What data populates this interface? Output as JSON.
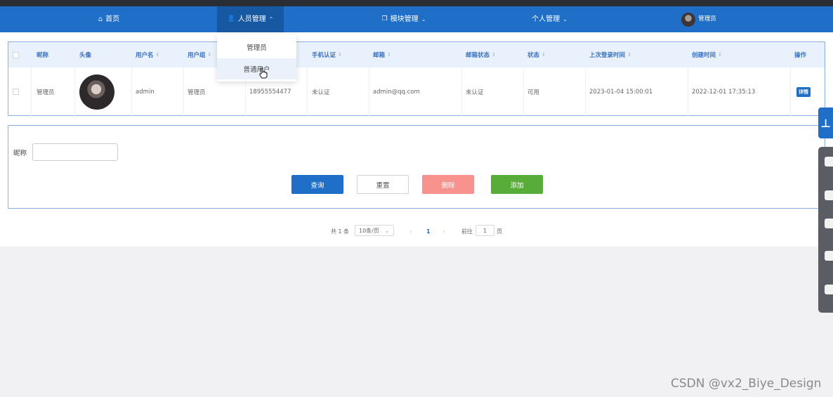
{
  "nav": {
    "home": "首页",
    "people": "人员管理",
    "modules": "模块管理",
    "personal": "个人管理",
    "user": "管理员"
  },
  "dropdown": {
    "items": [
      "管理员",
      "普通用户"
    ]
  },
  "table": {
    "headers": [
      "昵称",
      "头像",
      "用户名",
      "用户组",
      "手机认证",
      "邮箱",
      "邮箱状态",
      "状态",
      "上次登录时间",
      "创建时间",
      "操作"
    ],
    "rows": [
      {
        "nickname": "管理员",
        "username": "admin",
        "group": "管理员",
        "phone": "18955554477",
        "phone_auth": "未认证",
        "email": "admin@qq.com",
        "email_status": "未认证",
        "status": "可用",
        "last_login": "2023-01-04 15:00:01",
        "created": "2022-12-01 17:35:13",
        "action": "详情"
      }
    ]
  },
  "search": {
    "label": "昵称",
    "value": "",
    "buttons": {
      "query": "查询",
      "reset": "重置",
      "delete": "删除",
      "add": "添加"
    }
  },
  "pager": {
    "total": "共 1 条",
    "page_size": "10条/页",
    "current": "1",
    "goto_prefix": "前往",
    "goto_value": "1",
    "goto_suffix": "页"
  },
  "watermark": "CSDN @vx2_Biye_Design",
  "colors": {
    "nav": "#1f6fc9",
    "delete": "#f7928f",
    "add": "#58ad3a"
  }
}
